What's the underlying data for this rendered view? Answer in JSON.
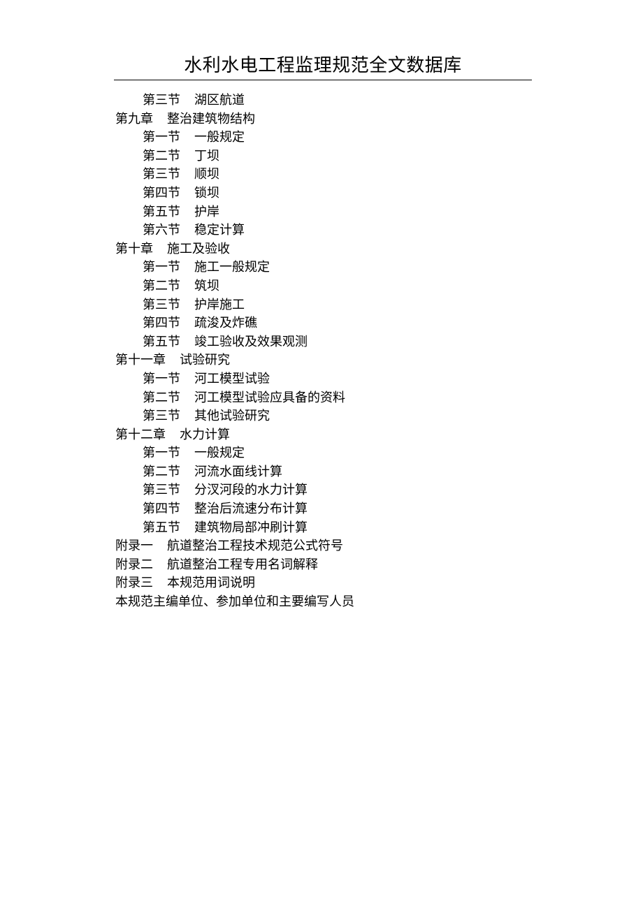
{
  "header": {
    "title": "水利水电工程监理规范全文数据库"
  },
  "toc": [
    {
      "level": 1,
      "label": "第三节",
      "title": "湖区航道"
    },
    {
      "level": 0,
      "label": "第九章",
      "title": "整治建筑物结构"
    },
    {
      "level": 1,
      "label": "第一节",
      "title": "一般规定"
    },
    {
      "level": 1,
      "label": "第二节",
      "title": "丁坝"
    },
    {
      "level": 1,
      "label": "第三节",
      "title": "顺坝"
    },
    {
      "level": 1,
      "label": "第四节",
      "title": "锁坝"
    },
    {
      "level": 1,
      "label": "第五节",
      "title": "护岸"
    },
    {
      "level": 1,
      "label": "第六节",
      "title": "稳定计算"
    },
    {
      "level": 0,
      "label": "第十章",
      "title": "施工及验收"
    },
    {
      "level": 1,
      "label": "第一节",
      "title": "施工一般规定"
    },
    {
      "level": 1,
      "label": "第二节",
      "title": "筑坝"
    },
    {
      "level": 1,
      "label": "第三节",
      "title": "护岸施工"
    },
    {
      "level": 1,
      "label": "第四节",
      "title": "疏浚及炸礁"
    },
    {
      "level": 1,
      "label": "第五节",
      "title": "竣工验收及效果观测"
    },
    {
      "level": 0,
      "label": "第十一章",
      "title": "试验研究"
    },
    {
      "level": 1,
      "label": "第一节",
      "title": "河工模型试验"
    },
    {
      "level": 1,
      "label": "第二节",
      "title": "河工模型试验应具备的资料"
    },
    {
      "level": 1,
      "label": "第三节",
      "title": "其他试验研究"
    },
    {
      "level": 0,
      "label": "第十二章",
      "title": "水力计算"
    },
    {
      "level": 1,
      "label": "第一节",
      "title": "一般规定"
    },
    {
      "level": 1,
      "label": "第二节",
      "title": "河流水面线计算"
    },
    {
      "level": 1,
      "label": "第三节",
      "title": "分汊河段的水力计算"
    },
    {
      "level": 1,
      "label": "第四节",
      "title": "整治后流速分布计算"
    },
    {
      "level": 1,
      "label": "第五节",
      "title": "建筑物局部冲刷计算"
    },
    {
      "level": 0,
      "label": "附录一",
      "title": "航道整治工程技术规范公式符号"
    },
    {
      "level": 0,
      "label": "附录二",
      "title": "航道整治工程专用名词解释"
    },
    {
      "level": 0,
      "label": "附录三",
      "title": "本规范用词说明"
    },
    {
      "level": 0,
      "label": "",
      "title": "本规范主编单位、参加单位和主要编写人员"
    }
  ]
}
